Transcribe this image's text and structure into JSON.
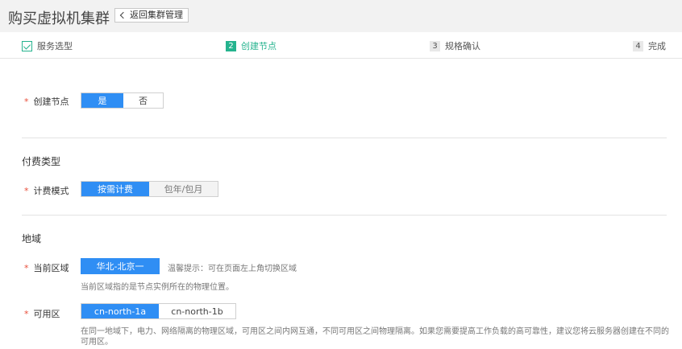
{
  "header": {
    "title": "购买虚拟机集群",
    "back_label": "返回集群管理"
  },
  "steps": [
    {
      "num": "",
      "label": "服务选型",
      "state": "done"
    },
    {
      "num": "2",
      "label": "创建节点",
      "state": "active"
    },
    {
      "num": "3",
      "label": "规格确认",
      "state": "pending"
    },
    {
      "num": "4",
      "label": "完成",
      "state": "pending"
    }
  ],
  "create_node": {
    "label": "创建节点",
    "options": [
      "是",
      "否"
    ],
    "selected": "是"
  },
  "billing": {
    "section_title": "付费类型",
    "label": "计费模式",
    "options": [
      "按需计费",
      "包年/包月"
    ],
    "selected": "按需计费"
  },
  "region": {
    "section_title": "地域",
    "current_label": "当前区域",
    "current_value": "华北-北京一",
    "tip": "温馨提示：可在页面左上角切换区域",
    "current_desc": "当前区域指的是节点实例所在的物理位置。",
    "az_label": "可用区",
    "az_options": [
      "cn-north-1a",
      "cn-north-1b"
    ],
    "az_selected": "cn-north-1a",
    "az_desc": "在同一地域下，电力、网络隔离的物理区域，可用区之间内网互通，不同可用区之间物理隔离。如果您需要提高工作负载的高可靠性，建议您将云服务器创建在不同的可用区。"
  },
  "colors": {
    "accent_blue": "#2f8ef4",
    "step_green": "#25b38e",
    "required_star": "#e84e3a"
  }
}
